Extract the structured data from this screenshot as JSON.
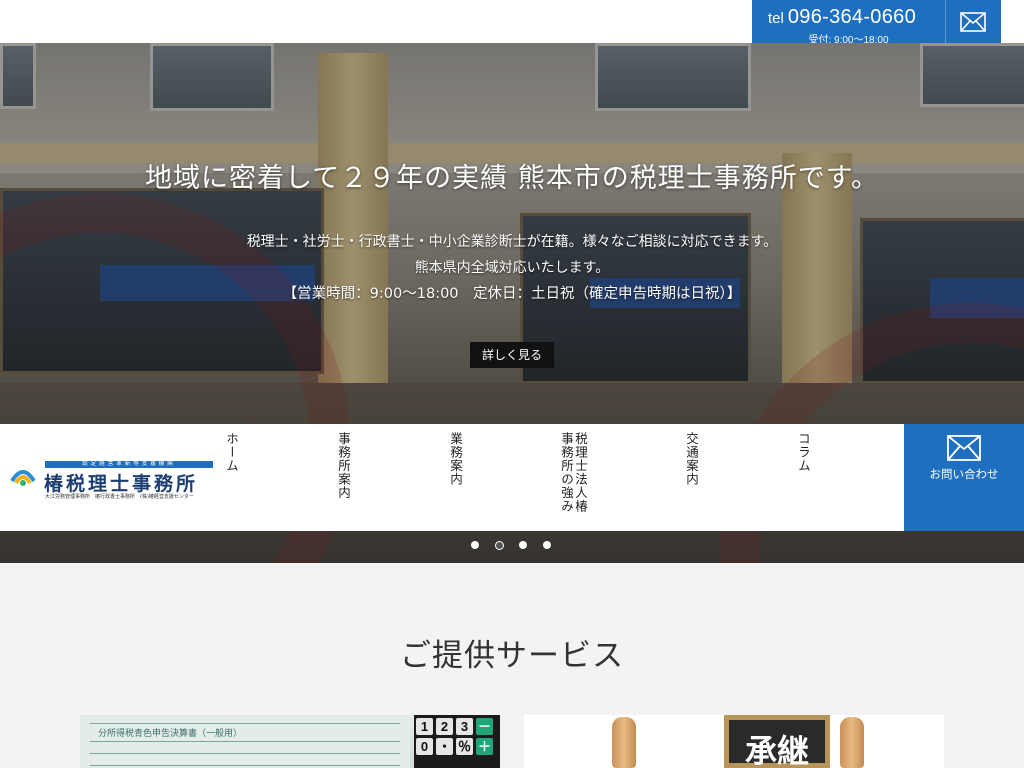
{
  "header": {
    "tel_prefix": "tel",
    "tel_number": "096-364-0660",
    "tel_hours": "受付: 9:00〜18:00",
    "mail_icon": "mail-icon"
  },
  "hero": {
    "title": "地域に密着して２９年の実績 熊本市の税理士事務所です。",
    "line1": "税理士・社労士・行政書士・中小企業診断士が在籍。様々なご相談に対応できます。",
    "line2": "熊本県内全域対応いたします。",
    "line3": "【営業時間：9:00～18:00　定休日：土日祝（確定申告時期は日祝）】",
    "button": "詳しく見る",
    "slides_total": 4,
    "active_slide": 2
  },
  "logo": {
    "top_band": "認定経営革新等支援機関",
    "name": "椿税理士事務所",
    "sub": "大江労務管理事務所　椿行政書士事務所　(株)椿経営支援センター"
  },
  "nav": {
    "items": [
      {
        "label": "ホーム"
      },
      {
        "label": "事務所案内"
      },
      {
        "label": "業務案内"
      },
      {
        "label": "税理士法人椿事務所の強み"
      },
      {
        "label": "交通案内"
      },
      {
        "label": "コラム"
      }
    ],
    "contact_label": "お問い合わせ"
  },
  "services": {
    "title": "ご提供サービス",
    "card_left": {
      "doc_heading": "分所得税青色申告決算書（一般用）",
      "calc_keys": [
        "1",
        "2",
        "3",
        "－",
        "0",
        "・",
        "％",
        "＋"
      ]
    },
    "card_right": {
      "board_text": "承継"
    }
  },
  "colors": {
    "brand_blue": "#1f6fc0",
    "button_black": "#111111",
    "logo_navy": "#1c3e72"
  }
}
